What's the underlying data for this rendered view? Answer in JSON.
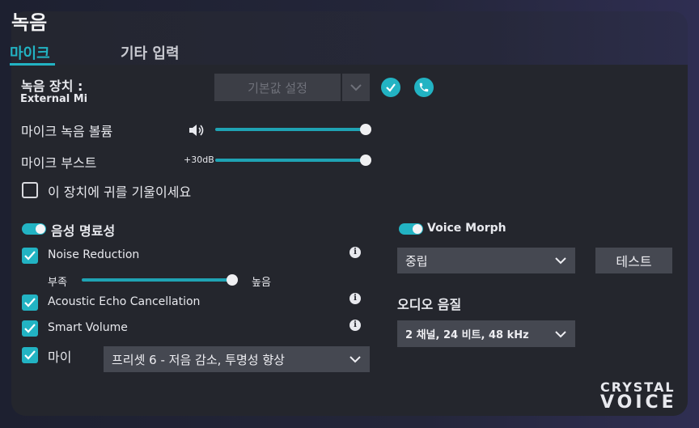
{
  "header": {
    "title": "녹음",
    "tabs": [
      {
        "label": "마이크",
        "active": true
      },
      {
        "label": "기타 입력",
        "active": false
      }
    ]
  },
  "device": {
    "label": "녹음 장치 :",
    "name": "External Mi",
    "default_button": "기본값 설정"
  },
  "mic_volume": {
    "label": "마이크 녹음 볼륨",
    "level": 1.0
  },
  "mic_boost": {
    "label": "마이크 부스트",
    "value_text": "+30dB",
    "level": 1.0
  },
  "listen": {
    "label": "이 장치에 귀를 기울이세요",
    "checked": false
  },
  "clarity": {
    "label": "음성 명료성",
    "enabled": true,
    "noise_reduction": {
      "label": "Noise Reduction",
      "checked": true
    },
    "nr_low": "부족",
    "nr_high": "높음",
    "nr_level": 1.0,
    "echo": {
      "label": "Acoustic Echo Cancellation",
      "checked": true
    },
    "smart_volume": {
      "label": "Smart Volume",
      "checked": true
    },
    "mic": {
      "label": "마이",
      "checked": true,
      "preset": "프리셋 6 - 저음 감소, 투명성 향상"
    }
  },
  "voice_morph": {
    "label": "Voice Morph",
    "enabled": true,
    "selected": "중립",
    "test_button": "테스트"
  },
  "audio_quality": {
    "label": "오디오 음질",
    "selected": "2 채널, 24 비트, 48 kHz"
  },
  "logo": {
    "line1": "CRYSTAL",
    "line2": "VOICE"
  },
  "colors": {
    "accent": "#22b3c3",
    "panel": "#24262d",
    "control": "#454851"
  }
}
